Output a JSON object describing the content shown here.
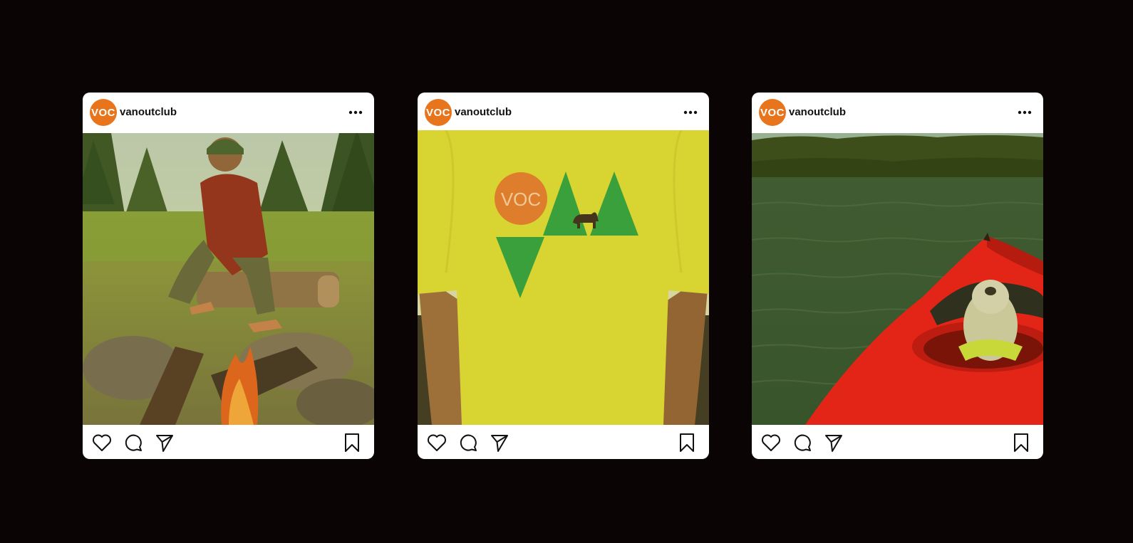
{
  "posts": [
    {
      "avatar_text": "VOC",
      "username": "vanoutclub",
      "image_icon": "photo-woman-campfire",
      "actions": [
        "heart-icon",
        "comment-icon",
        "share-icon",
        "bookmark-icon"
      ]
    },
    {
      "avatar_text": "VOC",
      "username": "vanoutclub",
      "image_icon": "photo-voc-tshirt",
      "shirt_logo_text": "VOC",
      "actions": [
        "heart-icon",
        "comment-icon",
        "share-icon",
        "bookmark-icon"
      ]
    },
    {
      "avatar_text": "VOC",
      "username": "vanoutclub",
      "image_icon": "photo-dog-in-kayak",
      "actions": [
        "heart-icon",
        "comment-icon",
        "share-icon",
        "bookmark-icon"
      ]
    }
  ],
  "colors": {
    "page_background": "#0b0405",
    "brand_orange": "#e8741c",
    "card_background": "#ffffff",
    "logo_green": "#2e9e3c",
    "kayak_red": "#e81e16"
  }
}
